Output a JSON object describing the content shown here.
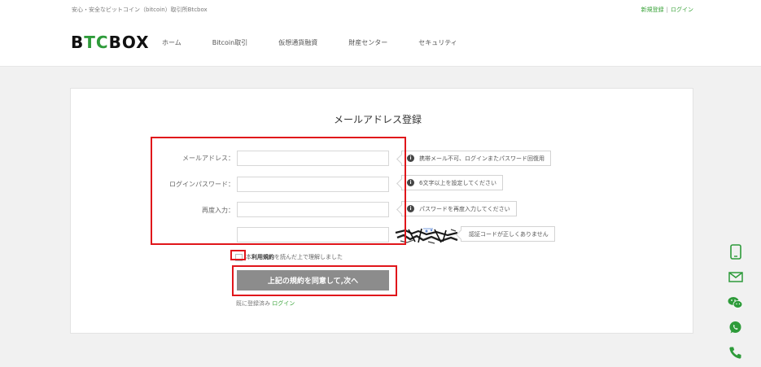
{
  "topbar": {
    "tagline": "安心・安全なビットコイン（bitcoin）取引所Btcbox",
    "register_label": "新規登録",
    "separator": "|",
    "login_label": "ログイン"
  },
  "header": {
    "logo_prefix": "B",
    "logo_highlight": "TC",
    "logo_suffix": "BOX",
    "nav": [
      {
        "label": "ホーム"
      },
      {
        "label": "Bitcoin取引"
      },
      {
        "label": "仮想通貨融資"
      },
      {
        "label": "財産センター"
      },
      {
        "label": "セキュリティ"
      }
    ]
  },
  "form": {
    "title": "メールアドレス登録",
    "email_label": "メールアドレス：",
    "email_value": "",
    "email_tip": "携帯メール不可、ログインまたパスワード回復用",
    "password_label": "ログインパスワード：",
    "password_value": "",
    "password_tip": "6文字以上を設定してください",
    "confirm_label": "再度入力：",
    "confirm_value": "",
    "confirm_tip": "パスワードを再度入力してください",
    "captcha_value": "",
    "captcha_tip": "認証コードが正しくありません",
    "agree_prefix": "本",
    "agree_terms": "利用規約",
    "agree_suffix": "を読んだ上で理解しました",
    "submit_label": "上記の規約を同意して,次へ",
    "already_text": "既に登録済み",
    "login_link": "ログイン"
  },
  "side_icons": [
    "phone-icon",
    "mail-icon",
    "wechat-icon",
    "whatsapp-icon",
    "call-icon"
  ],
  "colors": {
    "brand_green": "#2e9b3a",
    "link_green": "#3aa33a",
    "highlight_red": "#e0161b",
    "button_gray": "#8c8c8c"
  }
}
